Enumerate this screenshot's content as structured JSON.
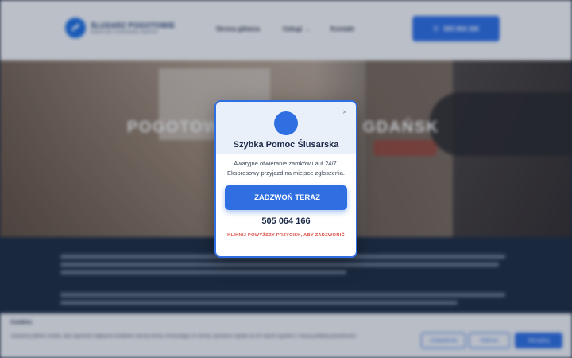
{
  "header": {
    "logo_name": "ŚLUSARZ POGOTOWIE",
    "logo_sub": "AWARYJNE OTWIERANIE ZAMKÓW",
    "nav": [
      {
        "label": "Strona główna"
      },
      {
        "label": "Usługi",
        "has_dropdown": true
      },
      {
        "label": "Kontakt"
      }
    ],
    "phone_label": "505 064 166",
    "phone_icon": "phone-icon"
  },
  "hero": {
    "title": "POGOTOWIE ŚLUSARSKIE GDAŃSK"
  },
  "cookie": {
    "title": "Cookies",
    "text": "Używamy plików cookie, aby zapewnić najlepsze działanie naszej strony. Korzystając ze strony, wyrażasz zgodę na ich użycie zgodnie z naszą polityką prywatności.",
    "buttons": {
      "settings": "Ustawienia",
      "reject": "Odrzuć",
      "accept": "Akceptuj"
    }
  },
  "modal": {
    "close_label": "×",
    "badge_icon": "",
    "title": "Szybka Pomoc Ślusarska",
    "description": "Awaryjne otwieranie zamków i aut 24/7. Ekspresowy przyjazd na miejsce zgłoszenia.",
    "call_button_icon": "",
    "call_button": "ZADZWOŃ TERAZ",
    "phone": "505 064 166",
    "hint": " KLIKNIJ POWYŻSZY PRZYCISK, ABY ZADZWONIĆ "
  },
  "colors": {
    "accent": "#2f6fe2",
    "title": "#1b2b47",
    "hint": "#e0524a",
    "dark_bg": "#1f2f45"
  }
}
